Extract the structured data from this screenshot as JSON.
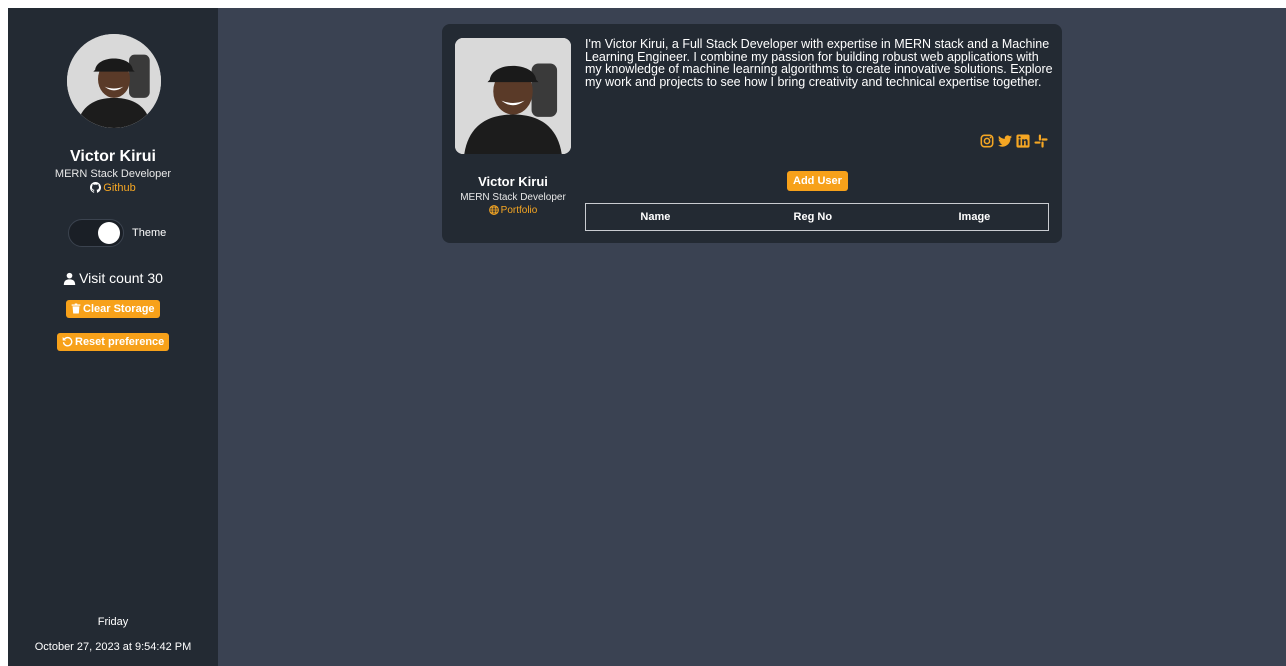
{
  "sidebar": {
    "name": "Victor Kirui",
    "role": "MERN Stack Developer",
    "github_label": "Github",
    "theme_label": "Theme",
    "visit_label": "Visit count 30",
    "clear_storage_label": "Clear Storage",
    "reset_preference_label": "Reset preference",
    "day": "Friday",
    "datetime": "October 27, 2023 at 9:54:42 PM"
  },
  "card": {
    "name": "Victor Kirui",
    "role": "MERN Stack Developer",
    "portfolio_label": "Portfolio",
    "bio": "I'm Victor Kirui, a Full Stack Developer with expertise in MERN stack and a Machine Learning Engineer. I combine my passion for building robust web applications with my knowledge of machine learning algorithms to create innovative solutions. Explore my work and projects to see how I bring creativity and technical expertise together.",
    "add_user_label": "Add User",
    "table_headers": [
      "Name",
      "Reg No",
      "Image"
    ],
    "socials": [
      "instagram-icon",
      "twitter-icon",
      "linkedin-icon",
      "slack-icon"
    ]
  },
  "colors": {
    "accent": "#f7a11a",
    "sidebar_bg": "#232a33",
    "main_bg": "#3a4252"
  }
}
